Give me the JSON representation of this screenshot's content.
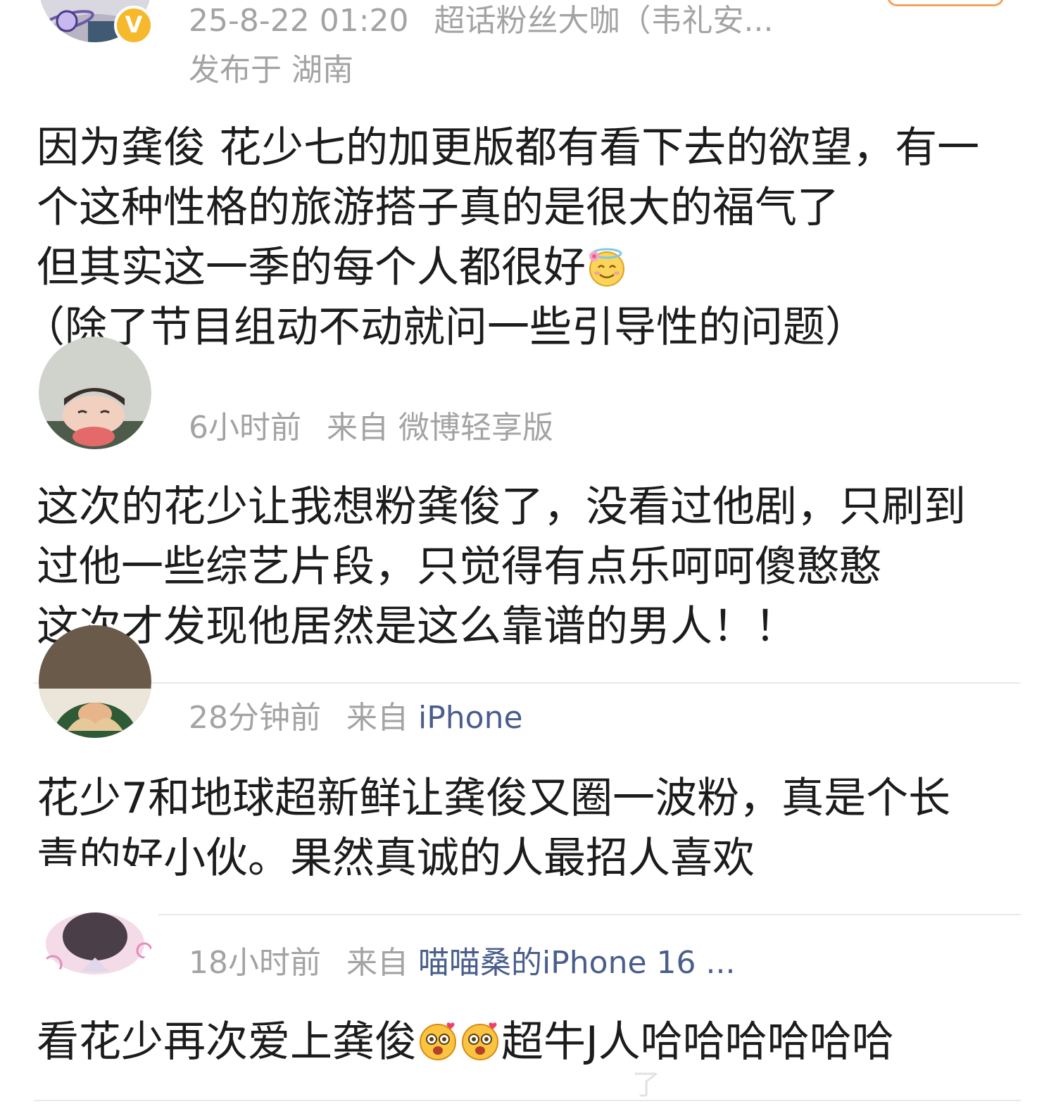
{
  "posts": [
    {
      "meta": {
        "time": "25-8-22 01:20",
        "source": "超话粉丝大咖（韦礼安...",
        "location": "发布于 湖南"
      },
      "lines": [
        "因为龚俊 花少七的加更版都有看下去的欲望，有一",
        "个这种性格的旅游搭子真的是很大的福气了",
        "但其实这一季的每个人都很好",
        "（除了节目组动不动就问一些引导性的问题）"
      ],
      "emoji": "angel-smile-emoji",
      "verified_label": "V"
    },
    {
      "meta": {
        "time": "6小时前",
        "source_prefix": "来自",
        "source": "微博轻享版"
      },
      "lines": [
        "这次的花少让我想粉龚俊了，没看过他剧，只刷到",
        "过他一些综艺片段，只觉得有点乐呵呵傻憨憨",
        "这次才发现他居然是这么靠谱的男人！！"
      ]
    },
    {
      "meta": {
        "time": "28分钟前",
        "source_prefix": "来自",
        "source": "iPhone"
      },
      "lines": [
        "花少7和地球超新鲜让龚俊又圈一波粉，真是个长",
        "青的好小伙。果然真诚的人最招人喜欢"
      ]
    },
    {
      "meta": {
        "time": "18小时前",
        "source_prefix": "来自",
        "source": "喵喵桑的iPhone 16 ..."
      },
      "lines": [
        "看花少再次爱上龚俊",
        "超牛J人哈哈哈哈哈哈"
      ],
      "emoji": "heart-eyes-emoji",
      "watermark": "了"
    }
  ],
  "colors": {
    "meta_gray": "#a3a3a3",
    "link_blue": "#4a5e8c",
    "text": "#1c1c1c",
    "divider": "#e9e9e9",
    "verified": "#f6b92b"
  }
}
